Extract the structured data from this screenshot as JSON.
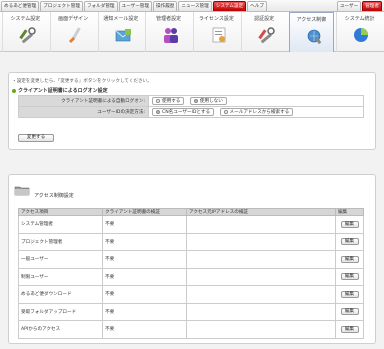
{
  "top_tabs": [
    {
      "label": "めるあど便管理",
      "active": false
    },
    {
      "label": "プロジェクト管理",
      "active": false
    },
    {
      "label": "フォルダ管理",
      "active": false
    },
    {
      "label": "ユーザー管理",
      "active": false
    },
    {
      "label": "操作履歴",
      "active": false
    },
    {
      "label": "ニュース管理",
      "active": false
    },
    {
      "label": "システム設定",
      "active": true
    },
    {
      "label": "ヘルプ",
      "active": false
    }
  ],
  "top_right_tabs": [
    {
      "label": "ユーザー",
      "active": false
    },
    {
      "label": "管理者",
      "active": true
    }
  ],
  "sub_tabs": [
    {
      "label": "システム設定",
      "icon": "settings-tools-icon"
    },
    {
      "label": "画面デザイン",
      "icon": "design-brush-icon"
    },
    {
      "label": "通知メール設定",
      "icon": "mail-icon"
    },
    {
      "label": "管理者設定",
      "icon": "admin-users-icon"
    },
    {
      "label": "ライセンス設定",
      "icon": "license-icon"
    },
    {
      "label": "認証設定",
      "icon": "auth-tools-icon"
    },
    {
      "label": "アクセス制御",
      "icon": "access-control-icon"
    },
    {
      "label": "システム統計",
      "icon": "statistics-icon"
    }
  ],
  "active_sub_tab": 6,
  "client_cert": {
    "description": "・設定を変更したら、「変更する」ボタンをクリックしてください。",
    "heading": "クライアント証明書によるログオン設定",
    "rows": [
      {
        "key": "クライアント証明書による自動ログオン:",
        "options": [
          "使用する",
          "使用しない"
        ],
        "selected": 1
      },
      {
        "key": "ユーザーIDの決定方法:",
        "options": [
          "CN名ユーザーIDとする",
          "メールアドレスから検索する"
        ],
        "selected": 0
      }
    ],
    "change_button": "変更する"
  },
  "access_control": {
    "title": "アクセス制御設定",
    "columns": [
      "アクセス項目",
      "クライアント証明書の検証",
      "アクセス元IPアドレスの検証",
      "編集"
    ],
    "rows": [
      {
        "item": "システム管理者",
        "cert": "不要",
        "ip": ""
      },
      {
        "item": "プロジェクト管理者",
        "cert": "不要",
        "ip": ""
      },
      {
        "item": "一般ユーザー",
        "cert": "不要",
        "ip": ""
      },
      {
        "item": "制限ユーザー",
        "cert": "不要",
        "ip": ""
      },
      {
        "item": "めるあど便ダウンロード",
        "cert": "不要",
        "ip": ""
      },
      {
        "item": "受取フォルダアップロード",
        "cert": "不要",
        "ip": ""
      },
      {
        "item": "APIからのアクセス",
        "cert": "不要",
        "ip": ""
      }
    ],
    "edit_label": "編集"
  }
}
